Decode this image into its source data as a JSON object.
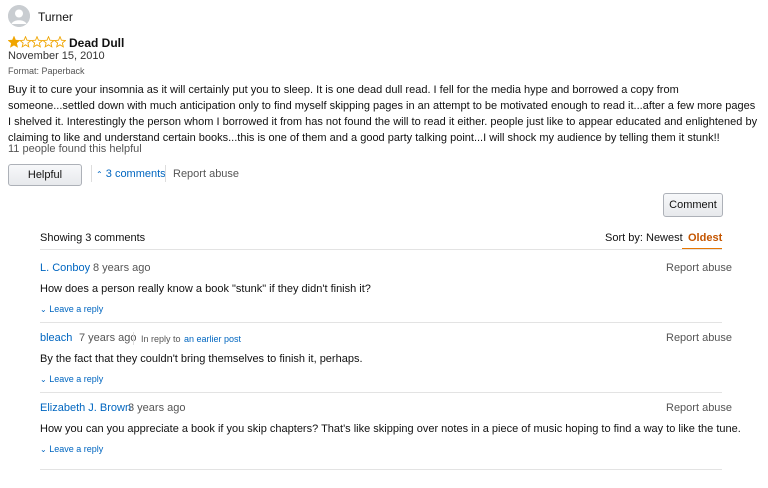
{
  "review": {
    "username": "Turner",
    "rating": 1,
    "max_rating": 5,
    "title": "Dead Dull",
    "date": "November 15, 2010",
    "format": "Format: Paperback",
    "body": "Buy it to cure your insomnia as it will certainly put you to sleep. It is one dead dull read. I fell for the media hype and borrowed a copy from someone...settled down with much anticipation only to find myself skipping pages in an attempt to be motivated enough to read it...after a few more pages I shelved it. Interestingly the person whom I borrowed it from has not found the will to read it either. people just like to appear educated and enlightened by claiming to like and understand certain books...this is one of them and a good party talking point...I will shock my audience by telling them it stunk!!",
    "helpful_count": "11 people found this helpful",
    "helpful_label": "Helpful",
    "comments_toggle": "3 comments",
    "report_label": "Report abuse"
  },
  "comments_section": {
    "comment_button": "Comment",
    "showing": "Showing 3 comments",
    "sort_label": "Sort by:",
    "sort_newest": "Newest",
    "sort_oldest": "Oldest",
    "active_sort": "Oldest",
    "comments": [
      {
        "author": "L. Conboy",
        "time": "8 years ago",
        "text": "How does a person really know a book \"stunk\" if they didn't finish it?",
        "reply_label": "Leave a reply",
        "report_label": "Report abuse"
      },
      {
        "author": "bleach",
        "time": "7 years ago",
        "in_reply_prefix": "In reply to",
        "in_reply_link": "an earlier post",
        "text": "By the fact that they couldn't bring themselves to finish it, perhaps.",
        "reply_label": "Leave a reply",
        "report_label": "Report abuse"
      },
      {
        "author": "Elizabeth J. Brown",
        "time": "3 years ago",
        "text": "How you can you appreciate a book if you skip chapters? That's like skipping over notes in a piece of music hoping to find a way to like the tune.",
        "reply_label": "Leave a reply",
        "report_label": "Report abuse"
      }
    ]
  },
  "colors": {
    "link": "#0066c0",
    "star": "#f0a500",
    "active_sort": "#c45500"
  },
  "icons": {
    "avatar": "user-avatar-icon",
    "stars": "star-rating-icon",
    "caret_up": "chevron-up-icon",
    "caret_down": "chevron-down-icon"
  }
}
